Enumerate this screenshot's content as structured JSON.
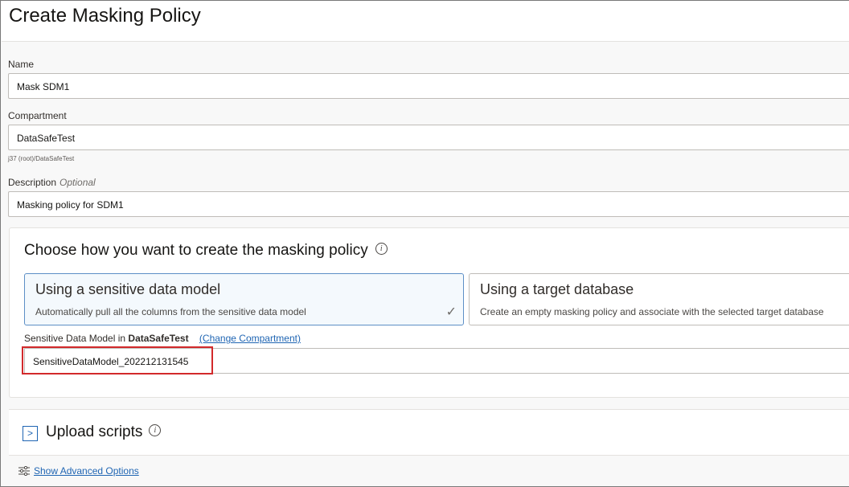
{
  "page": {
    "title": "Create Masking Policy"
  },
  "name_field": {
    "label": "Name",
    "value": "Mask SDM1"
  },
  "compartment_field": {
    "label": "Compartment",
    "value": "DataSafeTest",
    "path_hint": "j37 (root)/DataSafeTest"
  },
  "description_field": {
    "label": "Description",
    "optional_label": "Optional",
    "value": "Masking policy for SDM1"
  },
  "creation_method": {
    "heading": "Choose how you want to create the masking policy",
    "options": [
      {
        "title": "Using a sensitive data model",
        "description": "Automatically pull all the columns from the sensitive data model",
        "selected": true
      },
      {
        "title": "Using a target database",
        "description": "Create an empty masking policy and associate with the selected target database",
        "selected": false
      }
    ],
    "sdm_label_prefix": "Sensitive Data Model in",
    "sdm_compartment": "DataSafeTest",
    "change_compartment_link": "(Change Compartment)",
    "sdm_value": "SensitiveDataModel_202212131545",
    "highlight_color": "#d2292b"
  },
  "upload_scripts": {
    "title": "Upload scripts"
  },
  "advanced_options": {
    "link": "Show Advanced Options"
  },
  "icons": {
    "info": "info-icon",
    "check": "check-icon",
    "expand": "chevron-right-icon",
    "sliders": "sliders-icon"
  },
  "colors": {
    "link": "#1f65b3",
    "selected_card_border": "#5d8fc6",
    "selected_card_bg": "#f4f9fd"
  }
}
